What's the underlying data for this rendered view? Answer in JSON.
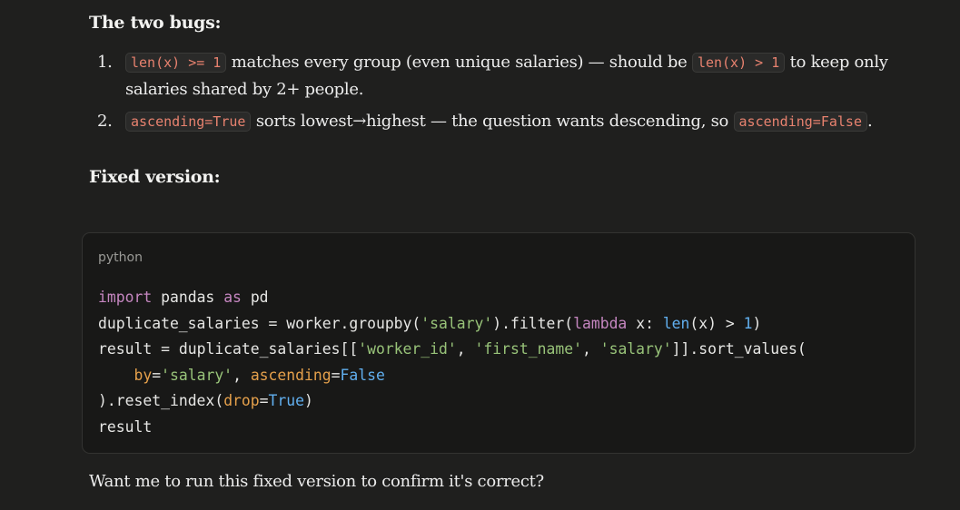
{
  "heading_bugs": "The two bugs:",
  "bugs": [
    {
      "number": "1.",
      "code1": "len(x) >= 1",
      "text1": " matches every group (even unique salaries) — should be ",
      "code2": "len(x) > 1",
      "text2": " to keep only salaries shared by 2+ people."
    },
    {
      "number": "2.",
      "code1": "ascending=True",
      "text1": " sorts lowest→highest — the question wants descending, so ",
      "code2": "ascending=False",
      "text2": "."
    }
  ],
  "heading_fixed": "Fixed version:",
  "code_block": {
    "language": "python",
    "lines": [
      "import pandas as pd",
      "duplicate_salaries = worker.groupby('salary').filter(lambda x: len(x) > 1)",
      "result = duplicate_salaries[['worker_id', 'first_name', 'salary']].sort_values(",
      "    by='salary', ascending=False",
      ").reset_index(drop=True)",
      "result"
    ]
  },
  "footer_text": "Want me to run this fixed version to confirm it's correct?"
}
